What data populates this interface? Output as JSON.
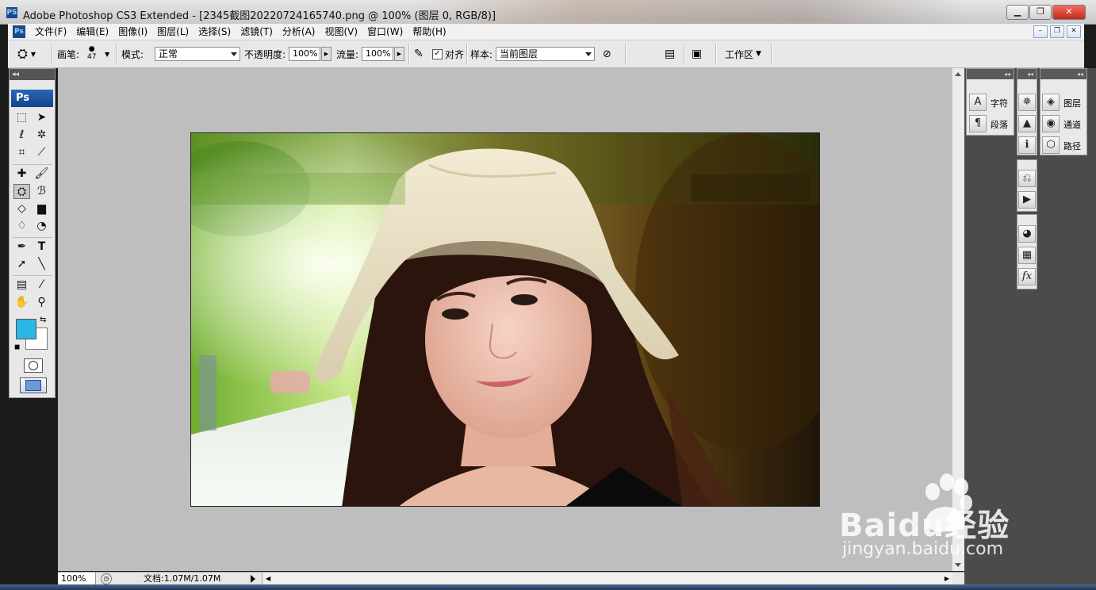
{
  "window": {
    "app_icon": "PS",
    "title": "Adobe Photoshop CS3 Extended - [2345截图20220724165740.png @ 100% (图层 0, RGB/8)]"
  },
  "menu": {
    "app_icon": "Ps",
    "items": [
      "文件(F)",
      "编辑(E)",
      "图像(I)",
      "图层(L)",
      "选择(S)",
      "滤镜(T)",
      "分析(A)",
      "视图(V)",
      "窗口(W)",
      "帮助(H)"
    ]
  },
  "options": {
    "brush_label": "画笔:",
    "brush_size": "47",
    "mode_label": "模式:",
    "mode_value": "正常",
    "opacity_label": "不透明度:",
    "opacity_value": "100%",
    "flow_label": "流量:",
    "flow_value": "100%",
    "aligned_label": "对齐",
    "aligned_checked": true,
    "sample_label": "样本:",
    "sample_value": "当前图层",
    "workspace_label": "工作区"
  },
  "toolbox": {
    "logo": "Ps",
    "foreground_color": "#2bb6e3",
    "background_color": "#ffffff"
  },
  "panels": {
    "column1": [
      {
        "icon": "character-icon",
        "label": "字符"
      },
      {
        "icon": "paragraph-icon",
        "label": "段落"
      }
    ],
    "column3": [
      {
        "icon": "layers-icon",
        "label": "图层"
      },
      {
        "icon": "channels-icon",
        "label": "通道"
      },
      {
        "icon": "paths-icon",
        "label": "路径"
      }
    ]
  },
  "status": {
    "zoom": "100%",
    "doc_info": "文档:1.07M/1.07M"
  },
  "watermark": {
    "brand": "Baidu经验",
    "url": "jingyan.baidu.com"
  }
}
